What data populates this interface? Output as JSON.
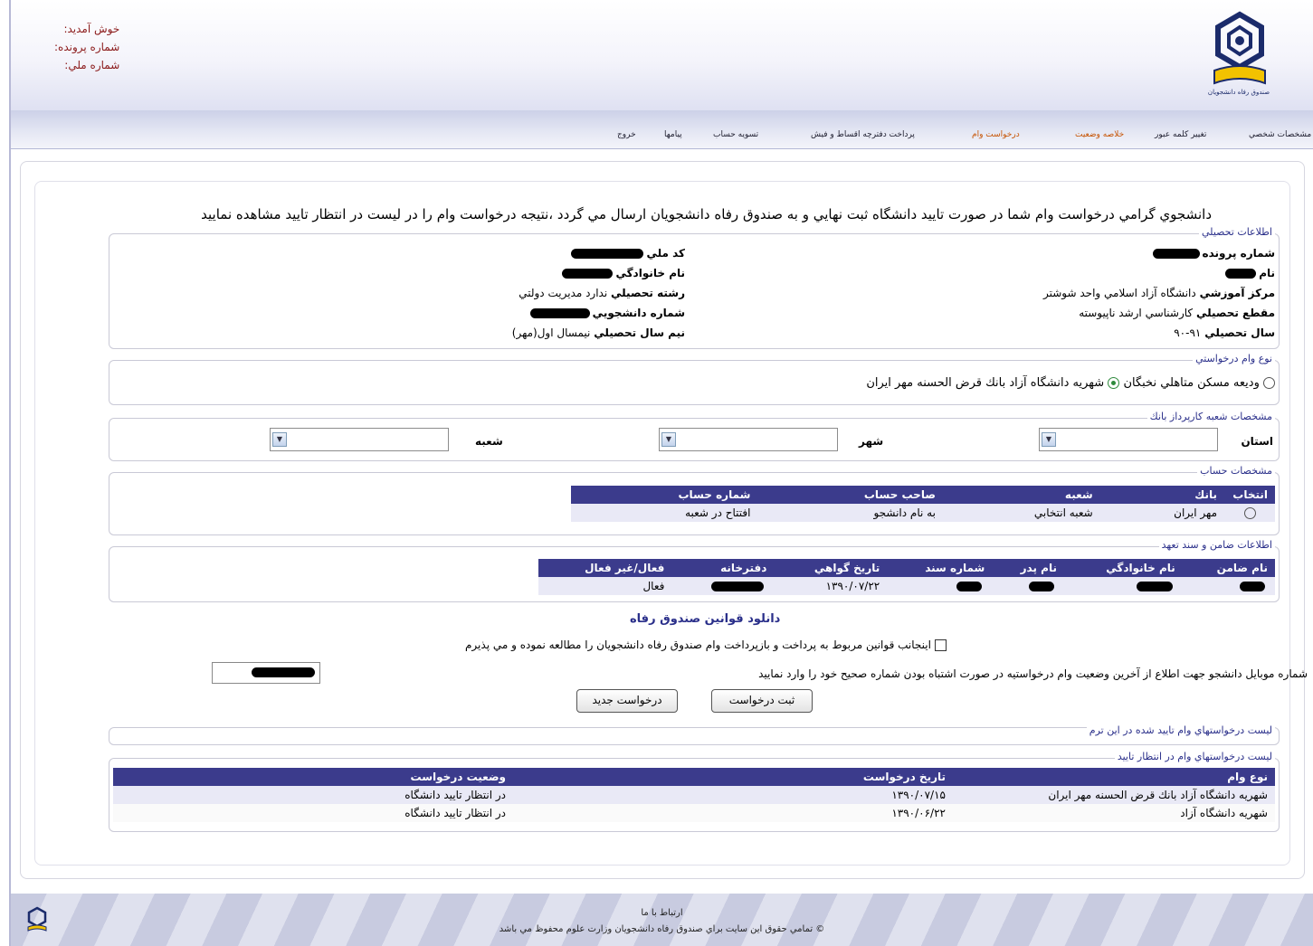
{
  "header": {
    "welcome": "خوش آمديد:",
    "file_no": "شماره پرونده:",
    "national_no": "شماره ملي:",
    "logo_caption": "صندوق رفاه دانشجويان"
  },
  "nav": [
    "مشخصات شخصي",
    "تغيير كلمه عبور",
    "خلاصه وضعيت",
    "درخواست وام",
    "پرداخت دفترچه اقساط و فيش",
    "تسويه حساب",
    "پيامها",
    "خروج"
  ],
  "colors": {
    "accent": "#3b3b8c",
    "nav_highlight": "#c65200",
    "welcome_text": "#8b1a1a",
    "legend": "#2a2f8a"
  },
  "notice": "دانشجوي گرامي درخواست وام شما در صورت تاييد دانشگاه ثبت نهايي و به صندوق رفاه دانشجويان ارسال مي گردد ،نتيجه درخواست وام را در ليست در انتظار تاييد مشاهده نماييد",
  "education": {
    "legend": "اطلاعات تحصيلي",
    "right": {
      "file_label": "شماره پرونده",
      "name_label": "نام",
      "center_label": "مركز آموزشي",
      "center_value": "دانشگاه آزاد اسلامي واحد شوشتر",
      "grade_label": "مقطع تحصيلي",
      "grade_value": "كارشناسي ارشد ناپيوسته",
      "year_label": "سال تحصيلي",
      "year_value": "۹۱-۹۰"
    },
    "left": {
      "nid_label": "كد ملي",
      "family_label": "نام خانوادگي",
      "field_label": "رشته تحصيلي",
      "field_value": "ندارد   مديريت دولتي",
      "student_no_label": "شماره دانشجويي",
      "semester_label": "نيم سال تحصيلي",
      "semester_value": "نيمسال اول(مهر)"
    }
  },
  "loan_type": {
    "legend": "نوع وام درخواستي",
    "option1": "وديعه مسكن متاهلي نخبگان",
    "option2": "شهريه دانشگاه آزاد بانك قرض الحسنه مهر ايران"
  },
  "branch": {
    "legend": "مشخصات شعبه كارپرداز بانك",
    "province_label": "استان",
    "city_label": "شهر",
    "branch_label": "شعبه"
  },
  "account": {
    "legend": "مشخصات حساب",
    "headers": [
      "انتخاب",
      "بانك",
      "شعبه",
      "صاحب حساب",
      "شماره حساب"
    ],
    "row": [
      "",
      "مهر ايران",
      "شعبه انتخابي",
      "به نام دانشجو",
      "افتتاح در شعبه"
    ]
  },
  "guarantor": {
    "legend": "اطلاعات ضامن و سند تعهد",
    "headers": [
      "نام ضامن",
      "نام خانوادگي",
      "نام پدر",
      "شماره سند",
      "تاريخ گواهي",
      "دفترخانه",
      "فعال/غير فعال"
    ],
    "row": {
      "date": "۱۳۹۰/۰۷/۲۲",
      "status": "فعال"
    }
  },
  "download_link": "دانلود قوانين صندوق رفاه",
  "agreement": "اينجانب قوانين مربوط به پرداخت و بازپرداخت وام صندوق رفاه دانشجويان را مطالعه نموده و مي پذيرم",
  "mobile_label": "شماره موبايل دانشجو جهت اطلاع از آخرين وضعيت وام درخواستيه در صورت اشتباه بودن شماره صحيح خود را وارد نماييد",
  "buttons": {
    "submit": "ثبت درخواست",
    "new": "درخواست جديد"
  },
  "approved": {
    "legend": "ليست درخواستهاي وام تاييد شده در اين ترم"
  },
  "pending": {
    "legend": "ليست درخواستهاي وام در انتظار تاييد",
    "headers": [
      "نوع وام",
      "تاريخ درخواست",
      "وضعيت درخواست"
    ],
    "rows": [
      [
        "شهريه دانشگاه آزاد بانك قرض الحسنه مهر ايران",
        "۱۳۹۰/۰۷/۱۵",
        "در انتظار تاييد دانشگاه"
      ],
      [
        "شهريه دانشگاه آزاد",
        "۱۳۹۰/۰۶/۲۲",
        "در انتظار تاييد دانشگاه"
      ]
    ]
  },
  "footer": {
    "contact": "ارتباط با ما",
    "copyright": "© تمامي حقوق اين سايت براي صندوق رفاه دانشجويان وزارت علوم محفوظ مي باشد"
  }
}
